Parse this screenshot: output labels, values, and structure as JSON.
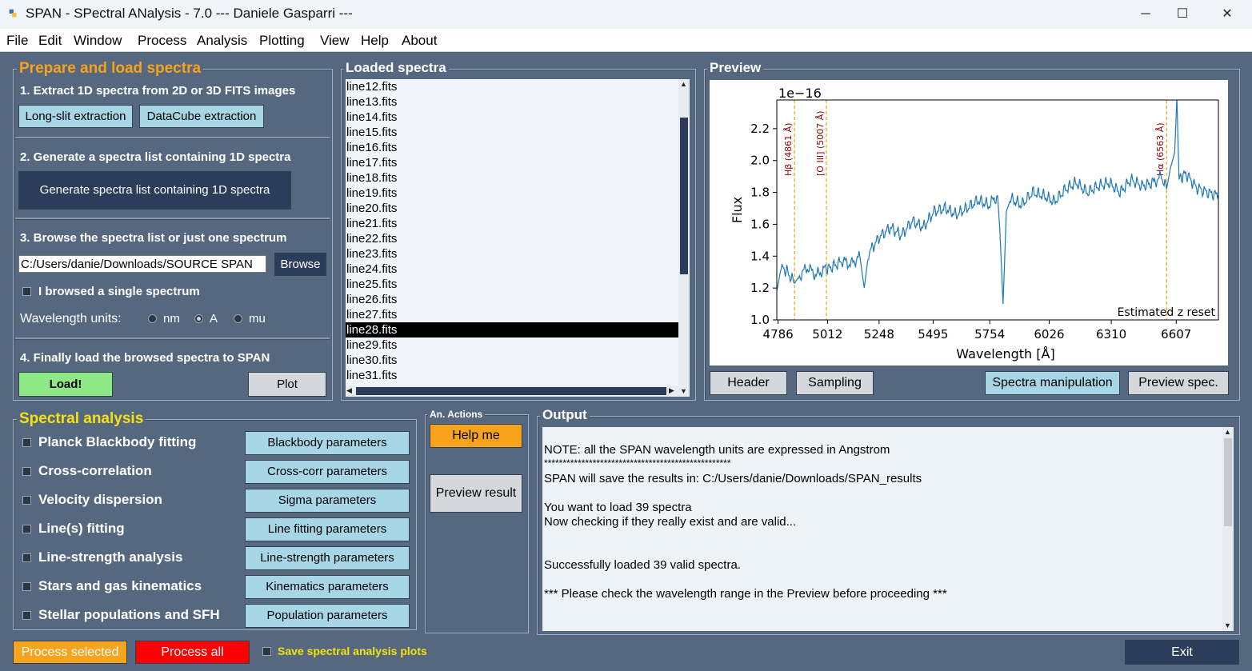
{
  "window": {
    "title": "SPAN - SPectral ANalysis - 7.0 --- Daniele Gasparri ---"
  },
  "menu": [
    "File",
    "Edit",
    "Window",
    "Process",
    "Analysis",
    "Plotting",
    "View",
    "Help",
    "About"
  ],
  "prepare": {
    "title": "Prepare and load spectra",
    "step1": "1. Extract 1D spectra from 2D or 3D FITS images",
    "longslit_btn": "Long-slit extraction",
    "datacube_btn": "DataCube extraction",
    "step2": "2. Generate a spectra list containing 1D spectra",
    "generate_btn": "Generate spectra list containing 1D spectra",
    "step3": "3. Browse the spectra list or just one spectrum",
    "path_value": "C:/Users/danie/Downloads/SOURCE SPAN",
    "browse_btn": "Browse",
    "single_label": "I browsed a single spectrum",
    "units_label": "Wavelength units:",
    "unit_nm": "nm",
    "unit_a": "A",
    "unit_mu": "mu",
    "step4": "4. Finally load the browsed spectra to SPAN",
    "load_btn": "Load!",
    "plot_btn": "Plot"
  },
  "loaded": {
    "title": "Loaded spectra",
    "files": [
      "line12.fits",
      "line13.fits",
      "line14.fits",
      "line15.fits",
      "line16.fits",
      "line17.fits",
      "line18.fits",
      "line19.fits",
      "line20.fits",
      "line21.fits",
      "line22.fits",
      "line23.fits",
      "line24.fits",
      "line25.fits",
      "line26.fits",
      "line27.fits",
      "line28.fits",
      "line29.fits",
      "line30.fits",
      "line31.fits"
    ],
    "selected": "line28.fits"
  },
  "preview": {
    "title": "Preview",
    "header_btn": "Header",
    "sampling_btn": "Sampling",
    "manip_btn": "Spectra manipulation",
    "previewspec_btn": "Preview spec."
  },
  "chart_data": {
    "type": "line",
    "xlabel": "Wavelength [Å]",
    "ylabel": "Flux",
    "scale_label": "1e−16",
    "xticks": [
      4786,
      5012,
      5248,
      5495,
      5754,
      6026,
      6310,
      6607
    ],
    "yticks": [
      1.0,
      1.2,
      1.4,
      1.6,
      1.8,
      2.0,
      2.2
    ],
    "xlim": [
      4780,
      6800
    ],
    "ylim": [
      1.0,
      2.38
    ],
    "lines": [
      {
        "label": "Hβ (4861 Å)",
        "x": 4861
      },
      {
        "label": "[O III] (5007 Å)",
        "x": 5007
      },
      {
        "label": "Hα (6563 Å)",
        "x": 6563
      }
    ],
    "annotation": "Estimated z reset",
    "line_color": "#1f77b4",
    "marker_color": "#f0a30a",
    "series": [
      {
        "x": [
          4780,
          4800,
          4830,
          4861,
          4880,
          4920,
          4960,
          5000,
          5030,
          5080,
          5120,
          5160,
          5180,
          5200,
          5250,
          5300,
          5350,
          5400,
          5450,
          5500,
          5550,
          5600,
          5650,
          5700,
          5750,
          5790,
          5800,
          5815,
          5830,
          5850,
          5900,
          5950,
          6000,
          6050,
          6100,
          6150,
          6200,
          6250,
          6300,
          6350,
          6400,
          6450,
          6500,
          6540,
          6563,
          6580,
          6600,
          6610,
          6620,
          6650,
          6700,
          6750,
          6800
        ],
        "y": [
          1.18,
          1.33,
          1.3,
          1.23,
          1.27,
          1.33,
          1.28,
          1.32,
          1.33,
          1.37,
          1.35,
          1.4,
          1.2,
          1.42,
          1.52,
          1.58,
          1.53,
          1.62,
          1.58,
          1.68,
          1.7,
          1.66,
          1.7,
          1.75,
          1.72,
          1.78,
          1.57,
          1.1,
          1.68,
          1.76,
          1.72,
          1.8,
          1.78,
          1.74,
          1.82,
          1.86,
          1.8,
          1.84,
          1.86,
          1.8,
          1.88,
          1.84,
          1.86,
          1.9,
          1.82,
          1.95,
          2.05,
          2.4,
          1.88,
          1.92,
          1.83,
          1.8,
          1.78
        ]
      }
    ]
  },
  "analysis": {
    "title": "Spectral analysis",
    "items": [
      {
        "label": "Planck Blackbody fitting",
        "btn": "Blackbody parameters"
      },
      {
        "label": "Cross-correlation",
        "btn": "Cross-corr parameters"
      },
      {
        "label": "Velocity dispersion",
        "btn": "Sigma parameters"
      },
      {
        "label": "Line(s) fitting",
        "btn": "Line fitting parameters"
      },
      {
        "label": "Line-strength analysis",
        "btn": "Line-strength parameters"
      },
      {
        "label": "Stars and gas kinematics",
        "btn": "Kinematics parameters"
      },
      {
        "label": "Stellar populations and SFH",
        "btn": "Population parameters"
      }
    ]
  },
  "actions": {
    "title": "An. Actions",
    "help_btn": "Help me",
    "preview_btn": "Preview result"
  },
  "output": {
    "title": "Output",
    "lines": [
      "NOTE: all the SPAN wavelength units are expressed in Angstrom",
      "**************************************************",
      "SPAN will save the results in: C:/Users/danie/Downloads/SPAN_results",
      "You want to load 39 spectra",
      "Now checking if they really exist and are valid...",
      "Successfully loaded 39 valid spectra.",
      "*** Please check the wavelength range in the Preview before proceeding ***"
    ]
  },
  "bottom": {
    "process_selected_btn": "Process selected",
    "process_all_btn": "Process all",
    "save_plots_label": "Save spectral analysis plots",
    "exit_btn": "Exit"
  }
}
